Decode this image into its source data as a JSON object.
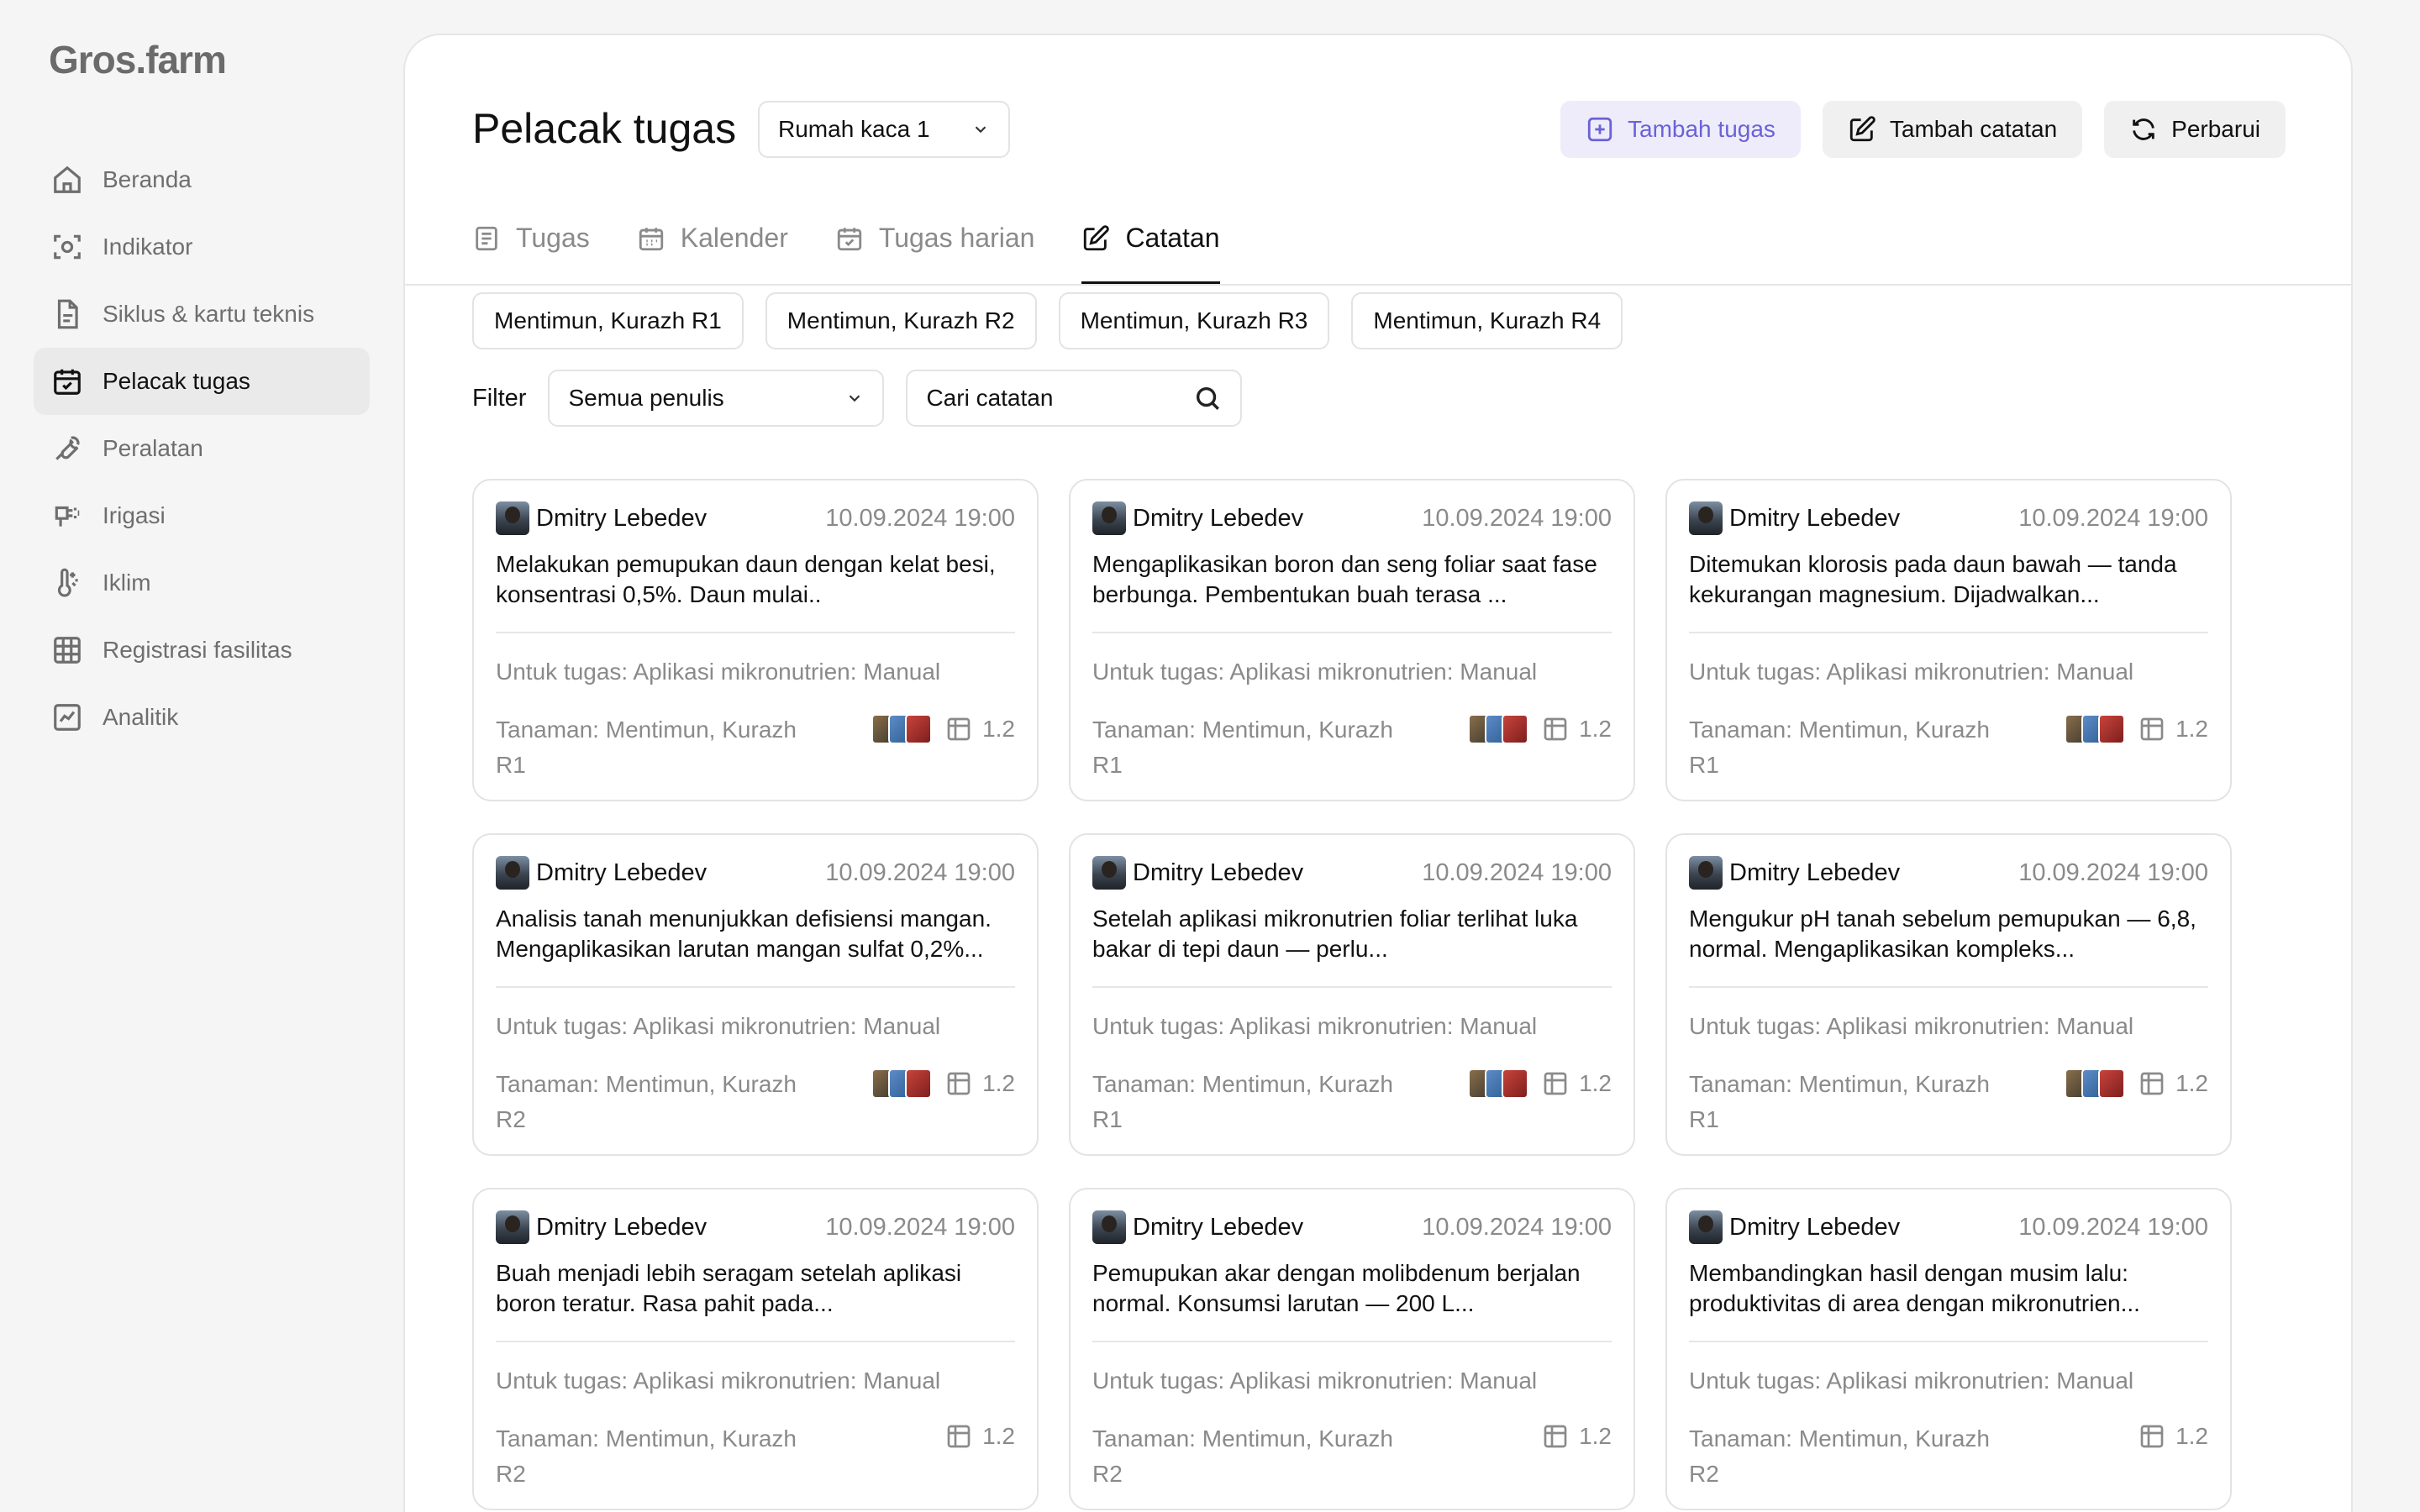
{
  "app": {
    "logo": "Gros.farm"
  },
  "sidebar": {
    "items": [
      {
        "label": "Beranda",
        "icon": "home-icon"
      },
      {
        "label": "Indikator",
        "icon": "sensor-icon"
      },
      {
        "label": "Siklus & kartu teknis",
        "icon": "document-icon"
      },
      {
        "label": "Pelacak tugas",
        "icon": "calendar-check-icon",
        "active": true
      },
      {
        "label": "Peralatan",
        "icon": "wrench-icon"
      },
      {
        "label": "Irigasi",
        "icon": "irrigation-icon"
      },
      {
        "label": "Iklim",
        "icon": "thermometer-icon"
      },
      {
        "label": "Registrasi fasilitas",
        "icon": "grid-icon"
      },
      {
        "label": "Analitik",
        "icon": "chart-icon"
      }
    ]
  },
  "header": {
    "title": "Pelacak tugas",
    "greenhouse": "Rumah kaca 1",
    "actions": {
      "add_task": "Tambah tugas",
      "add_note": "Tambah catatan",
      "refresh": "Perbarui"
    }
  },
  "tabs": [
    {
      "label": "Tugas",
      "icon": "task-list-icon"
    },
    {
      "label": "Kalender",
      "icon": "calendar-icon"
    },
    {
      "label": "Tugas harian",
      "icon": "calendar-check-icon"
    },
    {
      "label": "Catatan",
      "icon": "edit-icon",
      "active": true
    }
  ],
  "chips": [
    "Mentimun, Kurazh R1",
    "Mentimun, Kurazh R2",
    "Mentimun, Kurazh R3",
    "Mentimun, Kurazh R4"
  ],
  "filter": {
    "label": "Filter",
    "author": "Semua penulis",
    "search_placeholder": "Cari catatan"
  },
  "colors": {
    "accent": "#6a62d6",
    "accent_bg": "#eeecfb",
    "muted_text": "#8a8a8a"
  },
  "notes": [
    {
      "author": "Dmitry Lebedev",
      "date": "10.09.2024 19:00",
      "text": "Melakukan pemupukan daun dengan kelat besi, konsentrasi 0,5%. Daun mulai..",
      "task": "Untuk tugas: Aplikasi mikronutrien: Manual",
      "plant": "Tanaman: Mentimun, Kurazh R1",
      "photos": true,
      "count": "1.2"
    },
    {
      "author": "Dmitry Lebedev",
      "date": "10.09.2024 19:00",
      "text": "Mengaplikasikan boron dan seng foliar saat fase berbunga. Pembentukan buah terasa ...",
      "task": "Untuk tugas: Aplikasi mikronutrien: Manual",
      "plant": "Tanaman: Mentimun, Kurazh R1",
      "photos": true,
      "count": "1.2"
    },
    {
      "author": "Dmitry Lebedev",
      "date": "10.09.2024 19:00",
      "text": "Ditemukan klorosis pada daun bawah — tanda kekurangan magnesium. Dijadwalkan...",
      "task": "Untuk tugas: Aplikasi mikronutrien: Manual",
      "plant": "Tanaman: Mentimun, Kurazh R1",
      "photos": true,
      "count": "1.2"
    },
    {
      "author": "Dmitry Lebedev",
      "date": "10.09.2024 19:00",
      "text": "Analisis tanah menunjukkan defisiensi mangan. Mengaplikasikan larutan mangan sulfat 0,2%...",
      "task": "Untuk tugas: Aplikasi mikronutrien: Manual",
      "plant": "Tanaman: Mentimun, Kurazh R2",
      "photos": true,
      "count": "1.2"
    },
    {
      "author": "Dmitry Lebedev",
      "date": "10.09.2024 19:00",
      "text": "Setelah aplikasi mikronutrien foliar terlihat luka bakar di tepi daun — perlu...",
      "task": "Untuk tugas: Aplikasi mikronutrien: Manual",
      "plant": "Tanaman: Mentimun, Kurazh R1",
      "photos": true,
      "count": "1.2"
    },
    {
      "author": "Dmitry Lebedev",
      "date": "10.09.2024 19:00",
      "text": "Mengukur pH tanah sebelum pemupukan — 6,8, normal. Mengaplikasikan kompleks...",
      "task": "Untuk tugas: Aplikasi mikronutrien: Manual",
      "plant": "Tanaman: Mentimun, Kurazh R1",
      "photos": true,
      "count": "1.2"
    },
    {
      "author": "Dmitry Lebedev",
      "date": "10.09.2024 19:00",
      "text": "Buah menjadi lebih seragam setelah aplikasi boron teratur. Rasa pahit pada...",
      "task": "Untuk tugas: Aplikasi mikronutrien: Manual",
      "plant": "Tanaman: Mentimun, Kurazh R2",
      "photos": false,
      "count": "1.2"
    },
    {
      "author": "Dmitry Lebedev",
      "date": "10.09.2024 19:00",
      "text": "Pemupukan akar dengan molibdenum berjalan normal. Konsumsi larutan — 200 L...",
      "task": "Untuk tugas: Aplikasi mikronutrien: Manual",
      "plant": "Tanaman: Mentimun, Kurazh R2",
      "photos": false,
      "count": "1.2"
    },
    {
      "author": "Dmitry Lebedev",
      "date": "10.09.2024 19:00",
      "text": "Membandingkan hasil dengan musim lalu: produktivitas di area dengan mikronutrien...",
      "task": "Untuk tugas: Aplikasi mikronutrien: Manual",
      "plant": "Tanaman: Mentimun, Kurazh R2",
      "photos": false,
      "count": "1.2"
    }
  ]
}
